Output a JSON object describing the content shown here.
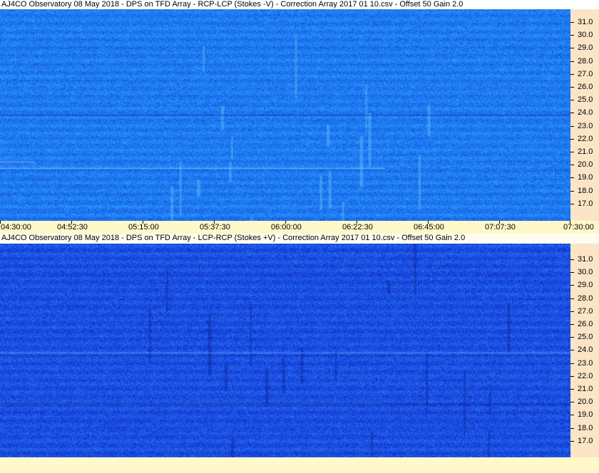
{
  "panels": [
    {
      "title": "AJ4CO Observatory 08 May 2018  -  DPS on TFD Array  -  RCP-LCP (Stokes -V)  -  Correction Array 2017 01 10.csv  -  Offset 50  Gain 2.0",
      "base_color": "#1f7af0",
      "freq_labels": [
        "31.0",
        "30.0",
        "29.0",
        "28.0",
        "27.0",
        "26.0",
        "25.0",
        "24.0",
        "23.0",
        "22.0",
        "21.0",
        "20.0",
        "19.0",
        "18.0",
        "17.0"
      ]
    },
    {
      "title": "AJ4CO Observatory 08 May 2018  -  DPS on TFD Array  -  LCP-RCP (Stokes +V)  -  Correction Array 2017 01 10.csv  -  Offset 50  Gain 2.0",
      "base_color": "#1b4fe0",
      "freq_labels": [
        "31.0",
        "30.0",
        "29.0",
        "28.0",
        "27.0",
        "26.0",
        "25.0",
        "24.0",
        "23.0",
        "22.0",
        "21.0",
        "20.0",
        "19.0",
        "18.0",
        "17.0"
      ]
    }
  ],
  "time_labels": [
    "04:30:00",
    "04:52:30",
    "05:15:00",
    "05:37:30",
    "06:00:00",
    "06:22:30",
    "06:45:00",
    "07:07:30",
    "07:30:00"
  ]
}
